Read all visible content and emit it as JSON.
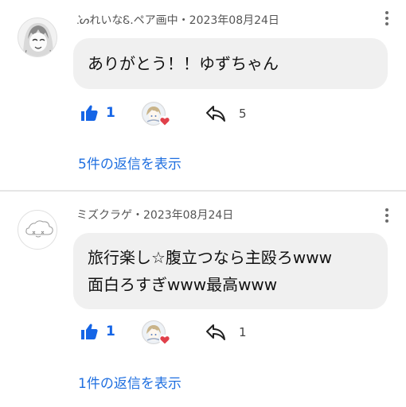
{
  "comments": [
    {
      "author": ".͛ᔕれいなᏋ.ペア画中",
      "separator": "・",
      "date": "2023年08月24日",
      "text_lines": [
        "ありがとう！！ゆずちゃん"
      ],
      "like_count": "1",
      "reply_count": "5",
      "view_replies_label": "5件の返信を表示"
    },
    {
      "author": "ミズクラゲ",
      "separator": "・",
      "date": "2023年08月24日",
      "text_lines": [
        "旅行楽し☆腹立つなら主殴ろwww",
        "面白ろすぎwww最高www"
      ],
      "like_count": "1",
      "reply_count": "1",
      "view_replies_label": "1件の返信を表示"
    }
  ],
  "colors": {
    "like_blue": "#1565e6",
    "link_blue": "#1f6fe0",
    "bubble_bg": "#f0f0f0",
    "heart_red": "#e0404a"
  },
  "icons": [
    "thumbs-up-icon",
    "reply-arrow-icon",
    "heart-icon",
    "more-vertical-icon"
  ]
}
